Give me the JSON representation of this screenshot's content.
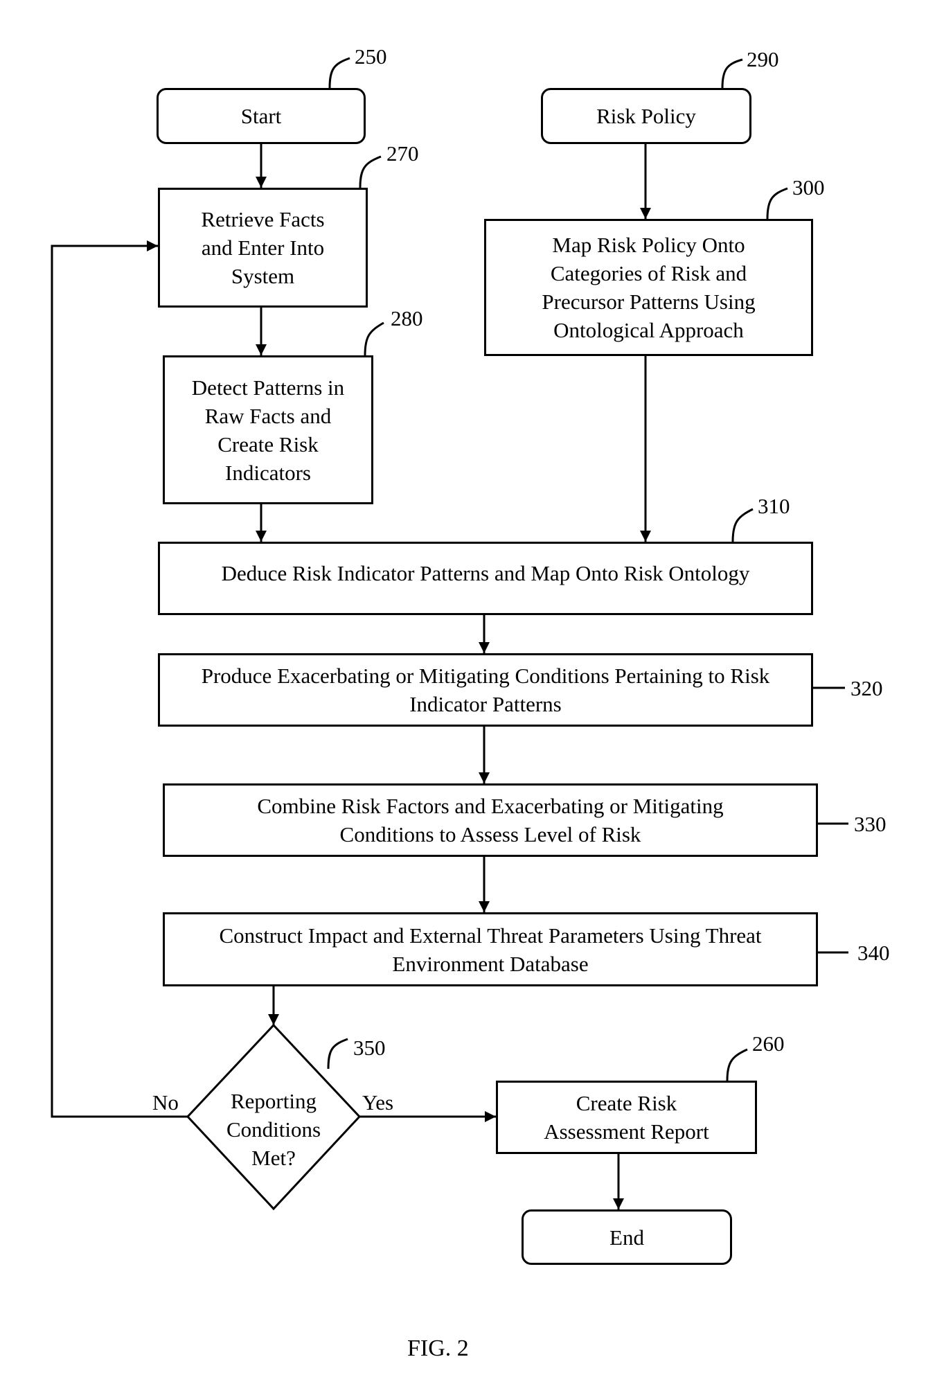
{
  "figure_label": "FIG. 2",
  "nodes": {
    "start": {
      "ref": "250",
      "text": "Start"
    },
    "retrieve": {
      "ref": "270",
      "text": "Retrieve Facts and Enter Into System"
    },
    "detect": {
      "ref": "280",
      "text": "Detect Patterns in Raw Facts and Create Risk Indicators"
    },
    "risk_policy": {
      "ref": "290",
      "text": "Risk Policy"
    },
    "map_policy": {
      "ref": "300",
      "text": "Map Risk Policy Onto Categories of Risk and Precursor Patterns Using Ontological Approach"
    },
    "deduce": {
      "ref": "310",
      "text": "Deduce Risk Indicator Patterns and Map Onto Risk Ontology"
    },
    "produce": {
      "ref": "320",
      "text": "Produce Exacerbating or Mitigating Conditions Pertaining to Risk Indicator Patterns"
    },
    "combine": {
      "ref": "330",
      "text": "Combine Risk Factors and Exacerbating or Mitigating Conditions to Assess Level of Risk"
    },
    "construct": {
      "ref": "340",
      "text": "Construct Impact and External Threat Parameters Using Threat Environment Database"
    },
    "decision": {
      "ref": "350",
      "text": "Reporting Conditions Met?",
      "no_label": "No",
      "yes_label": "Yes"
    },
    "create_report": {
      "ref": "260",
      "text": "Create Risk Assessment Report"
    },
    "end": {
      "text": "End"
    }
  }
}
